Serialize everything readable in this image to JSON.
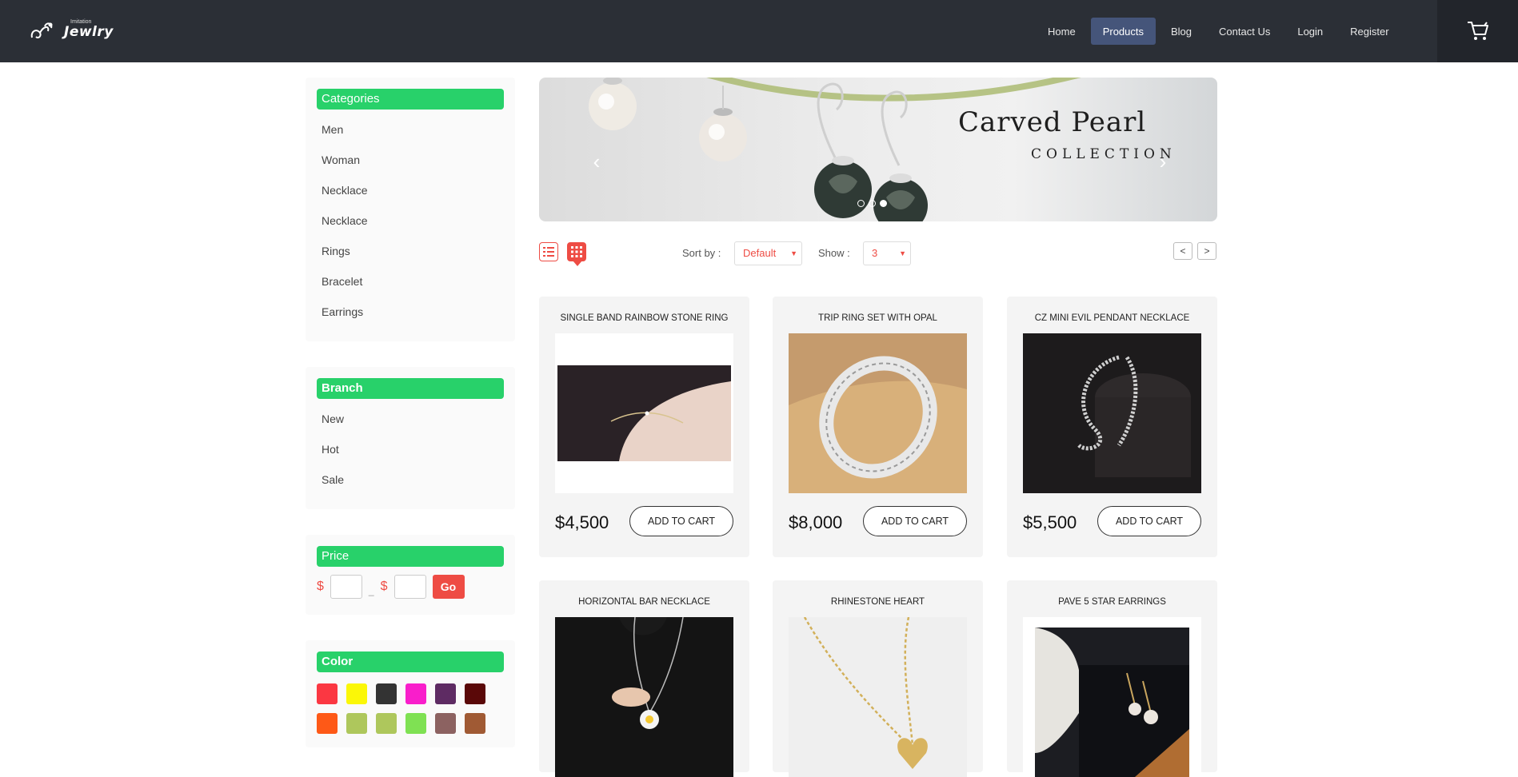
{
  "header": {
    "logo_small": "Imitation",
    "logo_big": "Jewlry",
    "nav": [
      {
        "label": "Home",
        "active": false
      },
      {
        "label": "Products",
        "active": true
      },
      {
        "label": "Blog",
        "active": false
      },
      {
        "label": "Contact Us",
        "active": false
      },
      {
        "label": "Login",
        "active": false
      },
      {
        "label": "Register",
        "active": false
      }
    ],
    "cart_icon": "shopping-cart-icon"
  },
  "sidebar": {
    "categories": {
      "title": "Categories",
      "items": [
        "Men",
        "Woman",
        "Necklace",
        "Necklace",
        "Rings",
        "Bracelet",
        "Earrings"
      ]
    },
    "branch": {
      "title": "Branch",
      "items": [
        "New",
        "Hot",
        "Sale"
      ]
    },
    "price": {
      "title": "Price",
      "currency": "$",
      "separator": "_",
      "go_label": "Go",
      "min_value": "",
      "max_value": ""
    },
    "color": {
      "title": "Color",
      "swatches": [
        "#fb3742",
        "#fbf707",
        "#333333",
        "#f91ecb",
        "#5e2b63",
        "#5a0808",
        "#fe5917",
        "#aec75c",
        "#aec75c",
        "#7fe153",
        "#8c6261",
        "#a05a34"
      ]
    }
  },
  "banner": {
    "title": "Carved Pearl",
    "subtitle": "COLLECTION",
    "prev_icon": "chevron-left-icon",
    "next_icon": "chevron-right-icon",
    "slide_count": 3,
    "active_slide": 3
  },
  "toolbar": {
    "sort_label": "Sort by :",
    "sort_value": "Default",
    "show_label": "Show :",
    "show_value": "3",
    "prev_page": "<",
    "next_page": ">"
  },
  "products": [
    {
      "name": "SINGLE BAND RAINBOW STONE RING",
      "price": "$4,500",
      "button": "ADD TO CART"
    },
    {
      "name": "TRIP RING SET WITH OPAL",
      "price": "$8,000",
      "button": "ADD TO CART"
    },
    {
      "name": "CZ MINI EVIL PENDANT NECKLACE",
      "price": "$5,500",
      "button": "ADD TO CART"
    },
    {
      "name": "HORIZONTAL BAR NECKLACE",
      "price": "",
      "button": ""
    },
    {
      "name": "RHINESTONE HEART",
      "price": "",
      "button": ""
    },
    {
      "name": "PAVE 5 STAR EARRINGS",
      "price": "",
      "button": ""
    }
  ]
}
